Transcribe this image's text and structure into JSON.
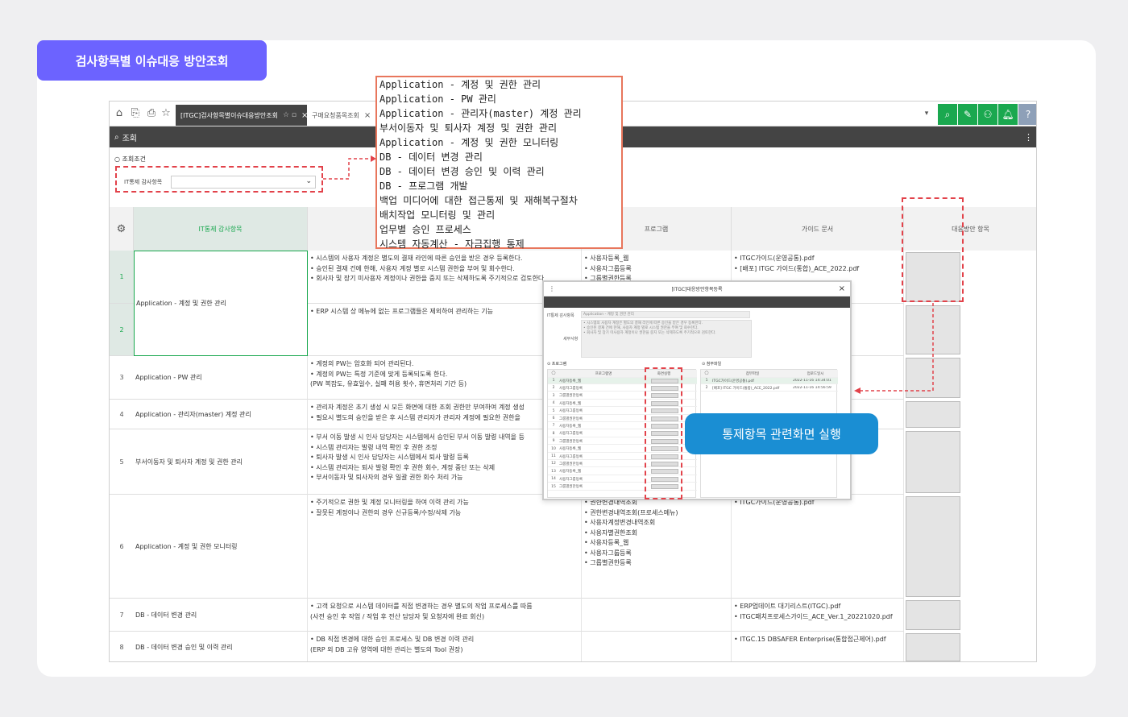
{
  "page_title": "검사항목별 이슈대응 방안조회",
  "toolbar": {
    "icons": [
      "home-icon",
      "export-icon",
      "print-icon",
      "star-icon"
    ],
    "tabs": [
      {
        "label": "[ITGC]검사항목별이슈대응방안조회",
        "active": true
      },
      {
        "label": "구매요청품목조회",
        "active": false
      }
    ],
    "dropdown_caret": "▾",
    "action_buttons": [
      "search-icon",
      "edit-icon",
      "user-settings-icon",
      "bell-icon",
      "help-icon"
    ]
  },
  "search_bar": {
    "label": "조회"
  },
  "filter": {
    "section_title": "조회조건",
    "label": "IT통제 감사항목",
    "value": ""
  },
  "grid": {
    "columns": [
      "IT통제 감사항목",
      "",
      "프로그램",
      "가이드 문서",
      "대응방안 항목"
    ],
    "rows": [
      {
        "num": "1",
        "item": "Application - 계정 및 권한 관리",
        "desc": [
          "• 시스템의 사용자 계정은 별도의 결재 라인에 따른 승인을 받은 경우 등록한다.",
          "• 승인된 결재 건에 한해, 사용자 계정 별로 시스템 권한을 부여 및 회수한다.",
          "• 회사자 및 장기 미사용자 계정이나 권한을 중지 또는 삭제하도록 주기적으로 검토한다"
        ],
        "programs": [
          "• 사용자등록_웹",
          "• 사용자그룹등록",
          "• 그룹별권한등록"
        ],
        "guides": [
          "• ITGC가이드(운영공통).pdf",
          "• [배포] ITGC 가이드(통합)_ACE_2022.pdf"
        ]
      },
      {
        "num": "2",
        "item": "",
        "desc": [
          "• ERP 시스템 상 메뉴에 없는 프로그램들은 제외하여 관리하는 기능"
        ],
        "programs": [],
        "guides": []
      },
      {
        "num": "3",
        "item": "Application - PW 관리",
        "desc": [
          "• 계정의 PW는 암호화 되어 관리된다.",
          "• 계정의 PW는 특정 기준에 맞게 등록되도록 한다.",
          "  (PW 복잡도, 유효일수, 실패 허용 횟수, 휴면처리 기간 등)"
        ],
        "programs": [],
        "guides": []
      },
      {
        "num": "4",
        "item": "Application - 관리자(master) 계정 관리",
        "desc": [
          "• 관리자 계정은 초기 생성 시 모든 화면에 대한 조회 권한만 부여하여 계정 생성",
          "• 필요시 별도의 승인을 받은 후 시스템 관리자가 관리자 계정에 필요한 권한을"
        ],
        "programs": [],
        "guides": []
      },
      {
        "num": "5",
        "item": "부서이동자 및 퇴사자 계정 및 권한 관리",
        "desc": [
          "• 부서 이동 발생 시 인사 담당자는 시스템에서 승인된 부서 이동 발령 내역을 등",
          "• 시스템 관리자는 발령 내역 확인 후 권한 조정",
          "• 퇴사자 발생 시 인사 담당자는 시스템에서 퇴사 발령 등록",
          "• 시스템 관리자는 퇴사 발령 확인 후 권한 회수, 계정 중단 또는 삭제",
          "• 부서이동자 및 퇴사자의 경우 일괄 권한 회수 처리 가능"
        ],
        "programs": [],
        "guides": []
      },
      {
        "num": "6",
        "item": "Application - 계정 및 권한 모니터링",
        "desc": [
          "• 주기적으로 권한 및 계정 모니터링을 하여 이력 관리 가능",
          "• 잘못된 계정이나 권한의 경우 신규등록/수정/삭제 가능"
        ],
        "programs": [
          "• 권한변경내역조회",
          "• 권한변경내역조회(프로세스메뉴)",
          "• 사용자계정변경내역조회",
          "• 사용자별권한조회",
          "• 사용자등록_웹",
          "• 사용자그룹등록",
          "• 그룹별권한등록"
        ],
        "guides": [
          "• ITGC가이드(운영공통).pdf"
        ]
      },
      {
        "num": "7",
        "item": "DB - 데이터 변경 관리",
        "desc": [
          "• 고객 요청으로 시스템 데이터를 직접 변경하는 경우 별도의 작업 프로세스를 따름",
          "  (사전 승인 후 작업 / 작업 후 전산 담당자 및 요청자에 완료 회신)"
        ],
        "programs": [],
        "guides": [
          "• ERP업데이트 대기리스트(ITGC).pdf",
          "• ITGC패치프로세스가이드_ACE_Ver.1_20221020.pdf"
        ]
      },
      {
        "num": "8",
        "item": "DB - 데이터 변경 승인 및 이력 관리",
        "desc": [
          "• DB 직접 변경에 대한 승인 프로세스 및 DB 변경 이력 관리",
          "  (ERP 외 DB 고유 영역에 대한 관리는 별도의 Tool 권장)"
        ],
        "programs": [],
        "guides": [
          "• ITGC.15 DBSAFER Enterprise(통합접근제어).pdf"
        ]
      }
    ]
  },
  "dropdown": {
    "options": [
      "Application - 계정 및 권한 관리",
      "Application - PW 관리",
      "Application - 관리자(master) 계정 관리",
      "부서이동자 및 퇴사자 계정 및 권한 관리",
      "Application - 계정 및 권한 모니터링",
      "DB - 데이터 변경 관리",
      "DB - 데이터 변경 승인 및 이력 관리",
      "DB - 프로그램 개발",
      "백업 미디어에 대한 접근통제 및 재해복구절차",
      "배치작업 모니터링 및 관리",
      "업무별 승인 프로세스",
      "시스템 자동계산 - 자금집행 통제"
    ]
  },
  "popup": {
    "title": "[ITGC]대응방안항목등록",
    "close": "×",
    "field1_label": "IT통제 감사항목",
    "field1_value": "Application - 계정 및 권한 관리",
    "field2_label": "세부사항",
    "field2_value": "• 시스템의 사용자 계정은 별도의 결재 라인에 따른 승인을 받은 경우 등록한다.\n• 승인된 결재 건에 한해, 사용자 계정 별로 시스템 권한을 부여 및 회수한다.\n• 회사자 및 장기 미사용자 계정이나 권한을 중지 또는 삭제하도록 주기적으로 검토한다.",
    "left_section": "프로그램",
    "left_cols": [
      "프로그램명",
      "화면실행"
    ],
    "left_rows": [
      {
        "n": "1",
        "name": "사용자등록_웹"
      },
      {
        "n": "2",
        "name": "사용자그룹등록"
      },
      {
        "n": "3",
        "name": "그룹별권한등록"
      },
      {
        "n": "4",
        "name": "사용자등록_웹"
      },
      {
        "n": "5",
        "name": "사용자그룹등록"
      },
      {
        "n": "6",
        "name": "그룹별권한등록"
      },
      {
        "n": "7",
        "name": "사용자등록_웹"
      },
      {
        "n": "8",
        "name": "사용자그룹등록"
      },
      {
        "n": "9",
        "name": "그룹별권한등록"
      },
      {
        "n": "10",
        "name": "사용자등록_웹"
      },
      {
        "n": "11",
        "name": "사용자그룹등록"
      },
      {
        "n": "12",
        "name": "그룹별권한등록"
      },
      {
        "n": "13",
        "name": "사용자등록_웹"
      },
      {
        "n": "14",
        "name": "사용자그룹등록"
      },
      {
        "n": "15",
        "name": "그룹별권한등록"
      }
    ],
    "right_section": "첨부파일",
    "right_cols": [
      "첨부파일",
      "업로드일시"
    ],
    "right_rows": [
      {
        "n": "1",
        "file": "ITGC가이드(운영공통).pdf",
        "date": "2022-11-16 14:34:01"
      },
      {
        "n": "2",
        "file": "[배포] ITGC 가이드(통합)_ACE_2022.pdf",
        "date": "2022-11-16 14:56:59"
      }
    ]
  },
  "callout": {
    "label": "통제항목 관련화면 실행"
  }
}
